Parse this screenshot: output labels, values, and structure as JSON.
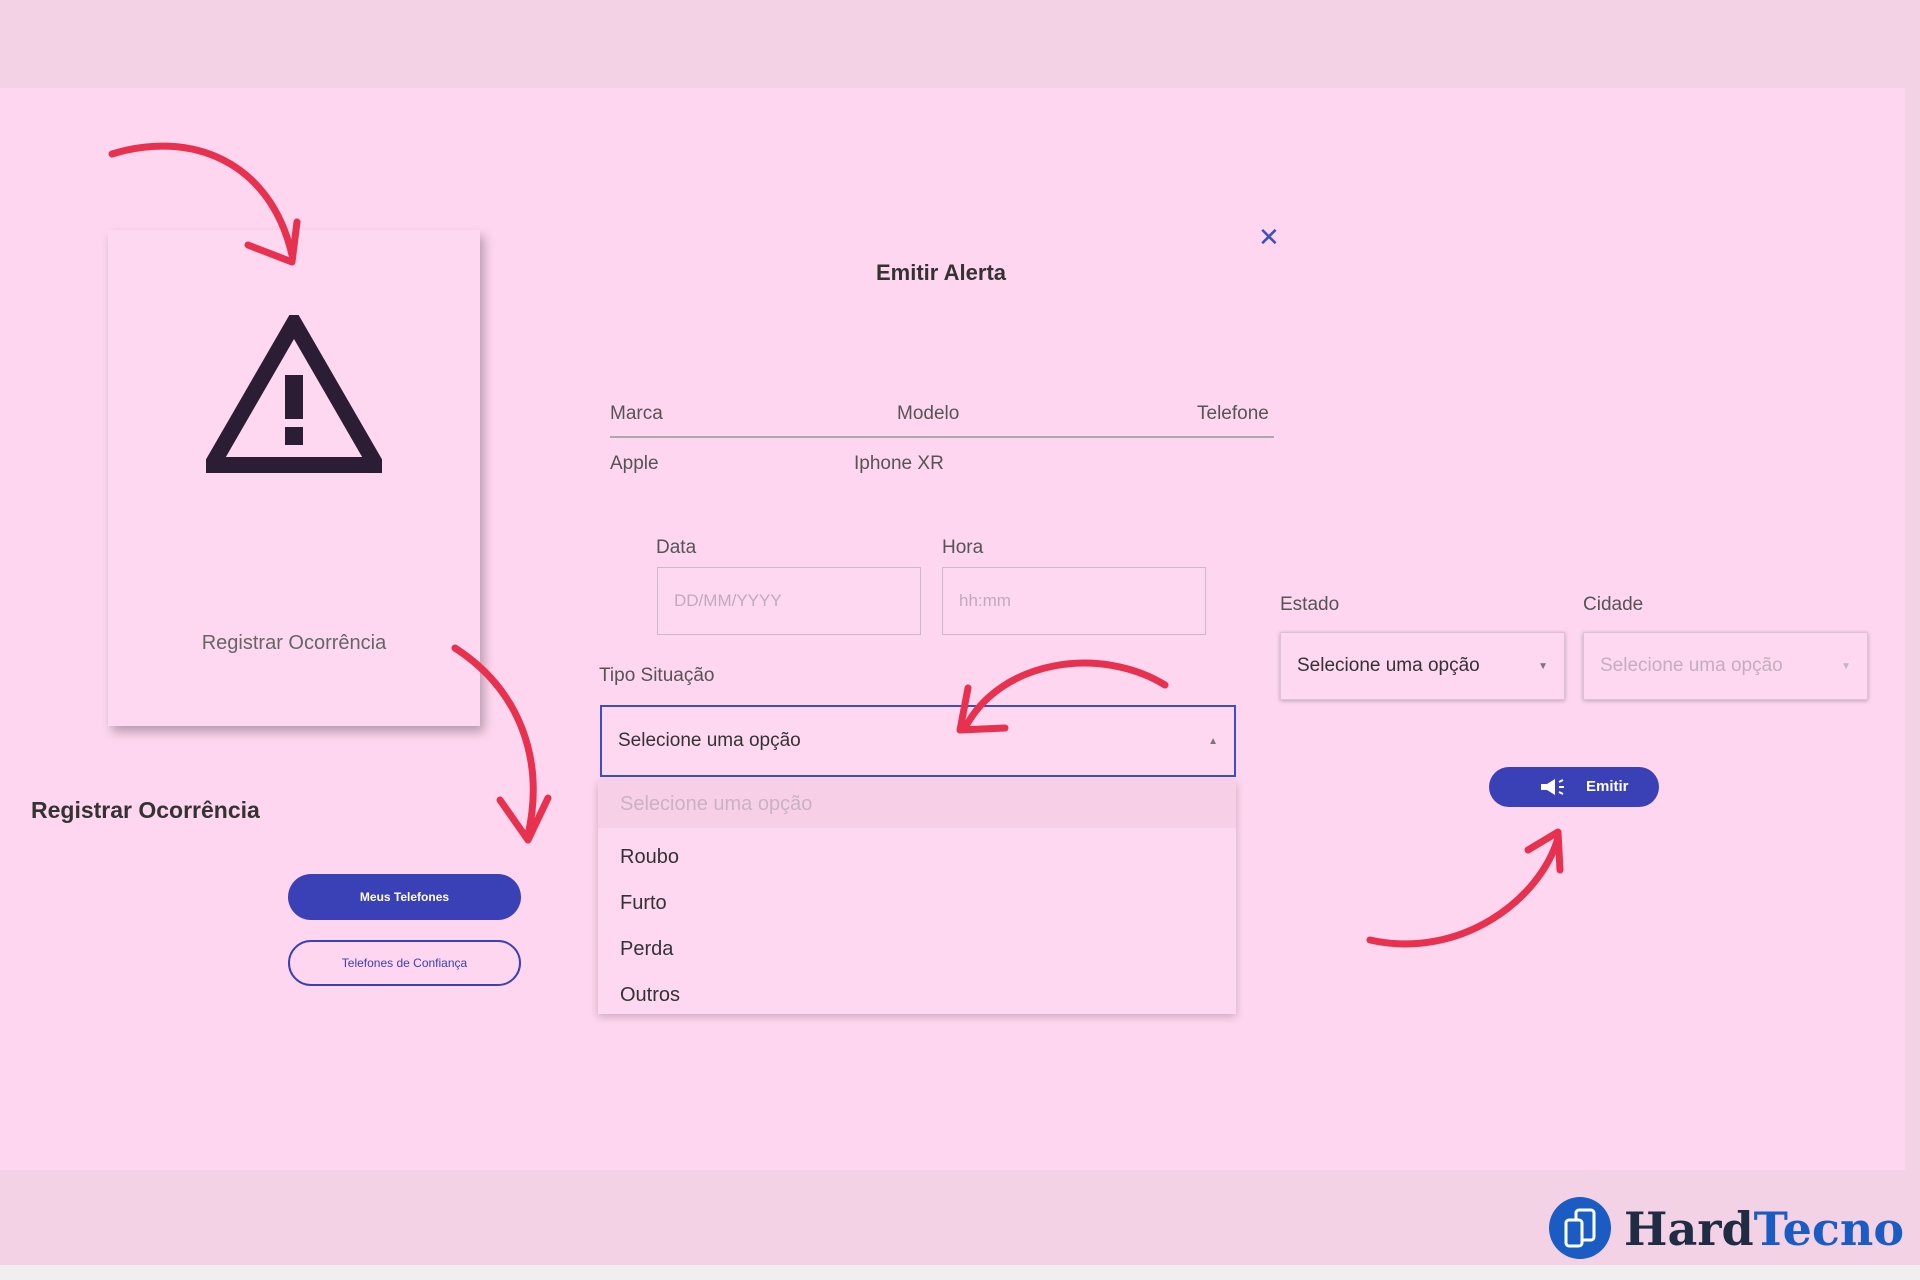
{
  "colors": {
    "background_band": "#f4d2e6",
    "panel": "#fed6ef",
    "accent": "#3a40b5",
    "arrow": "#e8304f",
    "logo_blue": "#1a5cc4",
    "logo_dark": "#1f2c44"
  },
  "card": {
    "icon": "warning-triangle-icon",
    "label": "Registrar Ocorrência"
  },
  "sidebar": {
    "title": "Registrar Ocorrência",
    "primary_button": "Meus Telefones",
    "secondary_button": "Telefones de Confiança"
  },
  "modal": {
    "title": "Emitir Alerta",
    "close_icon": "close-icon",
    "table": {
      "headers": [
        "Marca",
        "Modelo",
        "Telefone"
      ],
      "row": [
        "Apple",
        "Iphone XR",
        ""
      ]
    },
    "data_label": "Data",
    "data_placeholder": "DD/MM/YYYY",
    "hora_label": "Hora",
    "hora_placeholder": "hh:mm",
    "tipo_label": "Tipo Situação",
    "tipo_selected": "Selecione uma opção",
    "tipo_options": [
      "Selecione uma opção",
      "Roubo",
      "Furto",
      "Perda",
      "Outros"
    ],
    "estado_label": "Estado",
    "estado_selected": "Selecione uma opção",
    "cidade_label": "Cidade",
    "cidade_selected": "Selecione uma opção",
    "emit_button": "Emitir",
    "emit_icon": "megaphone-icon"
  },
  "logo": {
    "part1": "Hard",
    "part2": "Tecno",
    "icon": "phone-badge-icon"
  }
}
